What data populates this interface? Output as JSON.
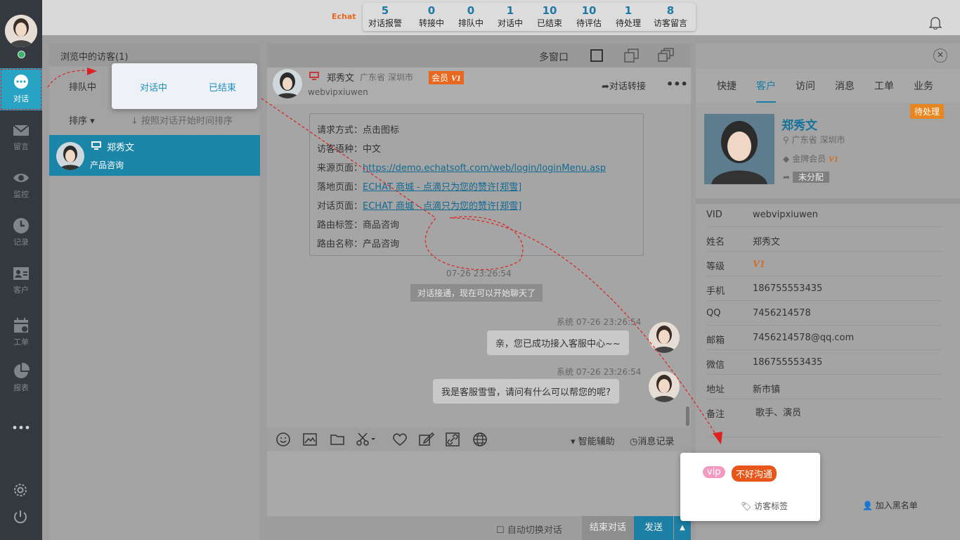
{
  "topbar": {
    "brand": "Echat",
    "stats": [
      {
        "n": "5",
        "l": "对话报警"
      },
      {
        "n": "0",
        "l": "转接中"
      },
      {
        "n": "0",
        "l": "排队中"
      },
      {
        "n": "1",
        "l": "对话中"
      },
      {
        "n": "10",
        "l": "已结束"
      },
      {
        "n": "10",
        "l": "待评估"
      },
      {
        "n": "1",
        "l": "待处理"
      },
      {
        "n": "8",
        "l": "访客留言"
      }
    ]
  },
  "nav": [
    {
      "label": "对话",
      "icon": "chat-bubble-icon"
    },
    {
      "label": "留言",
      "icon": "envelope-icon"
    },
    {
      "label": "监控",
      "icon": "eye-icon"
    },
    {
      "label": "记录",
      "icon": "clock-icon"
    },
    {
      "label": "客户",
      "icon": "contact-card-icon"
    },
    {
      "label": "工单",
      "icon": "calendar-icon"
    },
    {
      "label": "报表",
      "icon": "pie-chart-icon"
    }
  ],
  "visitors": {
    "header": "浏览中的访客(1)",
    "queue_tab": "排队中",
    "popup_tabs": [
      "对话中",
      "已结束"
    ],
    "sort_label": "排序",
    "sort_hint": "按照对话开始时间排序",
    "list": [
      {
        "name": "郑秀文",
        "topic": "产品咨询"
      }
    ]
  },
  "chat": {
    "multiwin": "多窗口",
    "name": "郑秀文",
    "location": "广东省 深圳市",
    "member_badge": "会员",
    "level": "V1",
    "visitor_id": "webvipxiuwen",
    "transfer": "对话转接",
    "info": [
      {
        "k": "请求方式：",
        "v": "点击图标",
        "link": false
      },
      {
        "k": "访客语种：",
        "v": "中文",
        "link": false
      },
      {
        "k": "来源页面：",
        "v": "https://demo.echatsoft.com/web/login/loginMenu.asp",
        "link": true
      },
      {
        "k": "落地页面：",
        "v": "ECHAT 商城 - 点滴只为您的赞许[郑雪]",
        "link": true
      },
      {
        "k": "对话页面：",
        "v": "ECHAT 商城 - 点滴只为您的赞许[郑雪]",
        "link": true
      },
      {
        "k": "路由标签：",
        "v": "商品咨询",
        "link": false
      },
      {
        "k": "路由名称：",
        "v": "产品咨询",
        "link": false
      }
    ],
    "time1": "07-26 23:26:54",
    "sys_note": "对话接通，现在可以开始聊天了",
    "msg1_meta": "系统  07-26 23:26:54",
    "msg1": "亲，您已成功接入客服中心~~",
    "msg2_meta": "系统  07-26 23:26:54",
    "msg2": "我是客服雪雪，请问有什么可以帮您的呢?",
    "assist": "智能辅助",
    "history": "消息记录",
    "auto_switch": "自动切换对话",
    "end_btn": "结束对话",
    "send_btn": "发送"
  },
  "customer": {
    "tabs": [
      "快捷",
      "客户",
      "访问",
      "消息",
      "工单",
      "业务"
    ],
    "pending": "待处理",
    "name": "郑秀文",
    "location": "广东省 深圳市",
    "member": "金牌会员",
    "level": "V1",
    "assign": "未分配",
    "fields": [
      {
        "k": "VID",
        "v": "webvipxiuwen"
      },
      {
        "k": "姓名",
        "v": "郑秀文"
      },
      {
        "k": "等级",
        "v": "V1"
      },
      {
        "k": "手机",
        "v": "186755553435"
      },
      {
        "k": "QQ",
        "v": "7456214578"
      },
      {
        "k": "邮箱",
        "v": "7456214578@qq.com"
      },
      {
        "k": "微信",
        "v": "186755553435"
      },
      {
        "k": "地址",
        "v": "新市镇"
      },
      {
        "k": "备注",
        "v": "歌手、演员"
      }
    ],
    "tag_vip": "vip",
    "tag_bad": "不好沟通",
    "visitor_tag": "访客标签",
    "blacklist": "加入黑名单"
  }
}
